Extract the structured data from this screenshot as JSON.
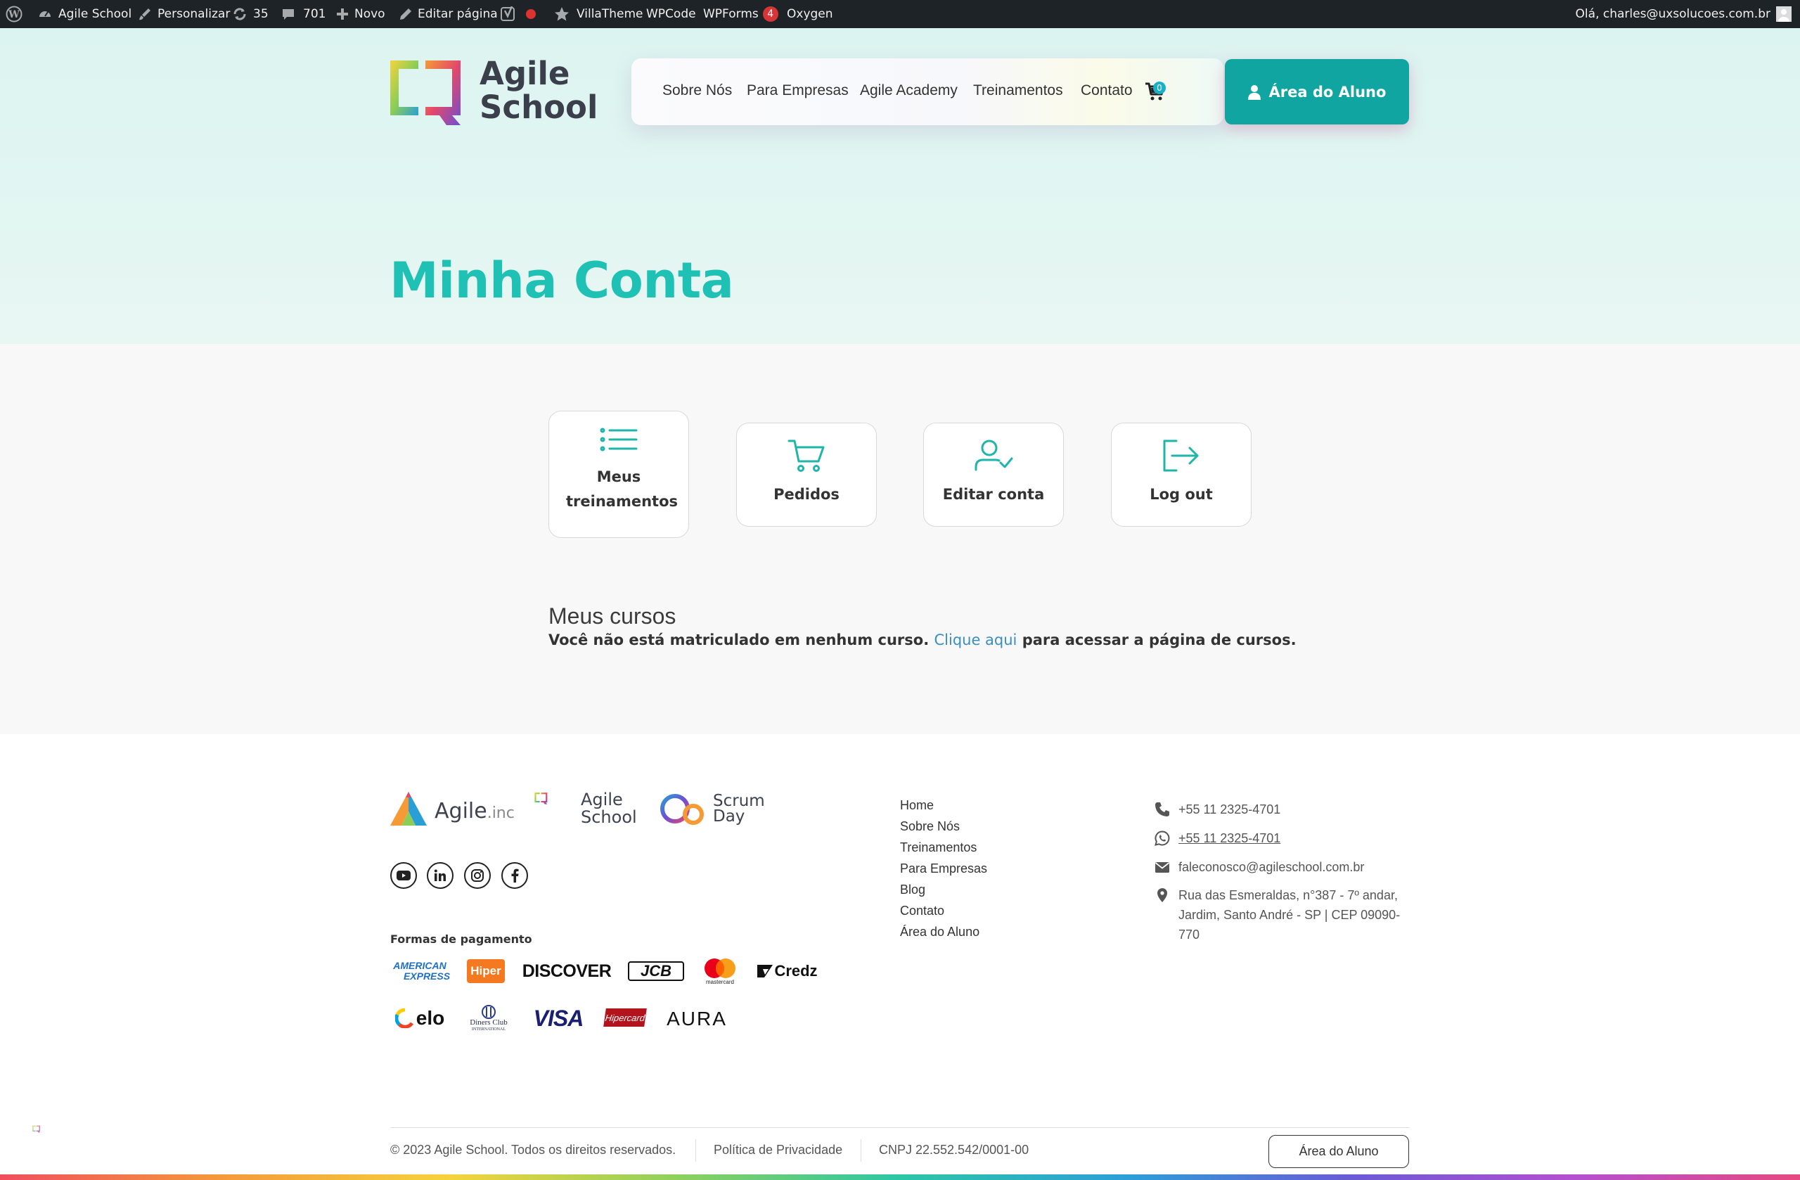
{
  "admin_bar": {
    "site_name": "Agile School",
    "customize": "Personalizar",
    "updates_count": "35",
    "comments_count": "701",
    "new": "Novo",
    "edit_page": "Editar página",
    "villatheme": "VillaTheme",
    "wpcode": "WPCode",
    "wpforms": "WPForms",
    "wpforms_badge": "4",
    "oxygen": "Oxygen",
    "greeting": "Olá, charles@uxsolucoes.com.br"
  },
  "header": {
    "logo_line1": "Agile",
    "logo_line2": "School",
    "nav": [
      "Sobre Nós",
      "Para Empresas",
      "Agile Academy",
      "Treinamentos",
      "Contato"
    ],
    "cart_count": "0",
    "student_area_button": "Área do Aluno"
  },
  "page_title": "Minha Conta",
  "account_menu": [
    {
      "label": "Meus treinamentos",
      "icon": "list-icon"
    },
    {
      "label": "Pedidos",
      "icon": "cart-icon"
    },
    {
      "label": "Editar conta",
      "icon": "user-check-icon"
    },
    {
      "label": "Log out",
      "icon": "logout-icon"
    }
  ],
  "courses": {
    "heading": "Meus cursos",
    "msg_before": "Você não está matriculado em nenhum curso.",
    "link": "Clique aqui",
    "msg_after": "para acessar a página de cursos."
  },
  "footer": {
    "brand_agile_inc": "Agile",
    "brand_agile_inc_suffix": ".inc",
    "brand_school_1": "Agile",
    "brand_school_2": "School",
    "brand_scrum_1": "Scrum",
    "brand_scrum_2": "Day",
    "social": [
      "youtube-icon",
      "linkedin-icon",
      "instagram-icon",
      "facebook-icon"
    ],
    "payment_title": "Formas de pagamento",
    "payments_row1": [
      "AMERICAN",
      "EXPRESS",
      "Hiper",
      "DISCOVER",
      "JCB",
      "mastercard",
      "Credz"
    ],
    "payments_row2": [
      "elo",
      "Diners Club",
      "INTERNATIONAL",
      "VISA",
      "Hipercard",
      "AURA"
    ],
    "links": [
      "Home",
      "Sobre Nós",
      "Treinamentos",
      "Para Empresas",
      "Blog",
      "Contato",
      "Área do Aluno"
    ],
    "phone": "+55 11 2325-4701",
    "whatsapp": "+55 11 2325-4701",
    "email": "faleconosco@agileschool.com.br",
    "address_line1": "Rua das Esmeraldas, n°387 - 7º andar,",
    "address_line2": "Jardim, Santo André - SP | CEP 09090-",
    "address_line3": "770",
    "copyright": "© 2023 Agile School. Todos os direitos reservados.",
    "privacy": "Política de Privacidade",
    "cnpj": "CNPJ 22.552.542/0001-00",
    "student_area": "Área do Aluno"
  },
  "colors": {
    "teal": "#10a5a0",
    "title": "#1fc1b4",
    "link": "#3a8fc2",
    "admin_bar": "#1d2327"
  }
}
